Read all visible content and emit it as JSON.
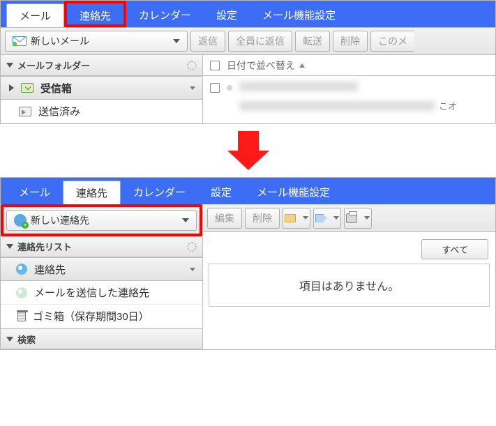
{
  "tabs": {
    "mail": "メール",
    "contacts": "連絡先",
    "calendar": "カレンダー",
    "settings": "設定",
    "mail_settings": "メール機能設定"
  },
  "panel1": {
    "compose_label": "新しいメール",
    "toolbar": {
      "reply": "返信",
      "reply_all": "全員に返信",
      "forward": "転送",
      "delete": "削除",
      "this_mail": "このメ"
    },
    "sidebar": {
      "title": "メールフォルダー",
      "inbox": "受信箱",
      "sent": "送信済み"
    },
    "list": {
      "sort_label": "日付で並べ替え",
      "snippet_suffix": "こオ"
    }
  },
  "panel2": {
    "compose_label": "新しい連絡先",
    "toolbar": {
      "edit": "編集",
      "delete": "削除"
    },
    "sidebar": {
      "title": "連絡先リスト",
      "contacts": "連絡先",
      "sent_contacts": "メールを送信した連絡先",
      "trash": "ゴミ箱（保存期間30日）",
      "search": "検索"
    },
    "list": {
      "all": "すべて",
      "empty": "項目はありません。"
    }
  }
}
